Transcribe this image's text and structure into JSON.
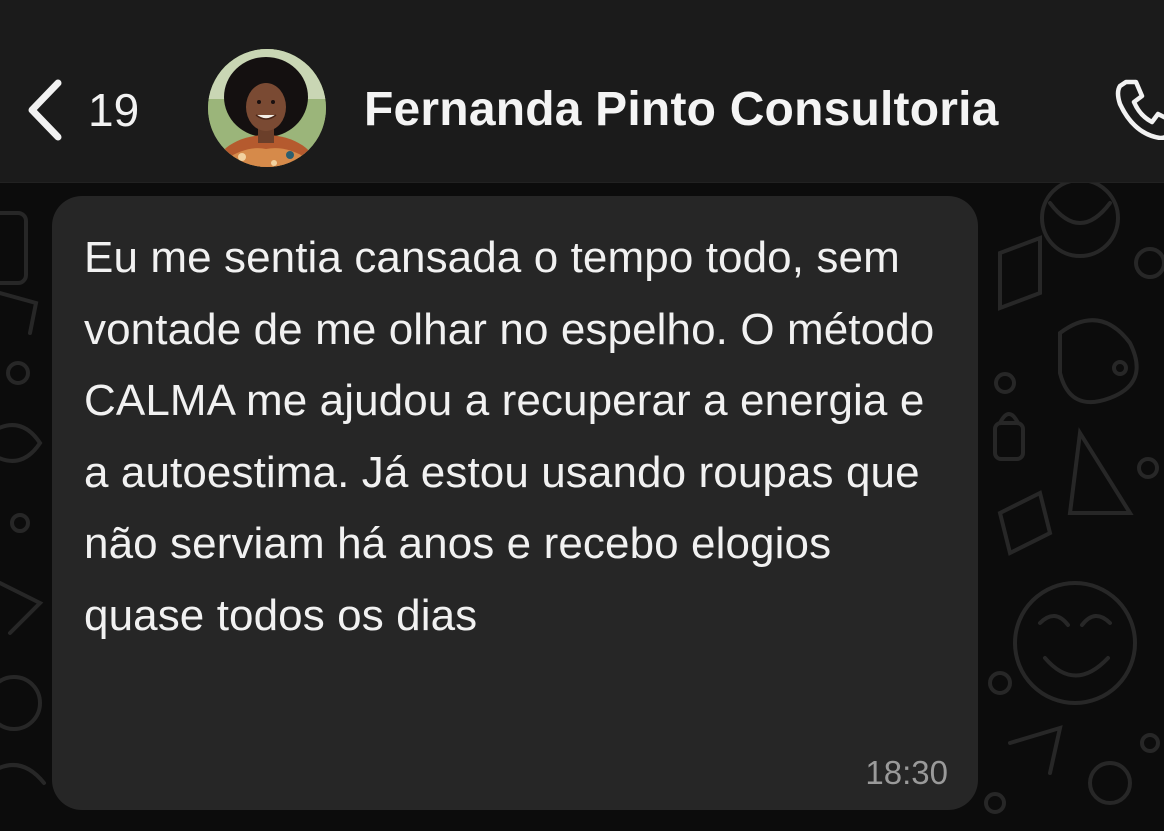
{
  "header": {
    "back_count": "19",
    "contact_name": "Fernanda Pinto Consultoria",
    "icons": {
      "back": "chevron-left-icon",
      "call": "phone-icon"
    }
  },
  "message": {
    "text": "Eu me sentia cansada o tempo todo, sem vontade de me olhar no espelho. O método CALMA me ajudou a recuperar a energia e a autoestima. Já estou usando roupas que não serviam há anos e recebo elogios quase todos os dias",
    "time": "18:30"
  },
  "colors": {
    "header_bg": "#1b1b1b",
    "chat_bg": "#0c0c0c",
    "bubble_bg": "#262626",
    "text": "#f1f1f1",
    "timestamp": "#9a9a9a"
  }
}
